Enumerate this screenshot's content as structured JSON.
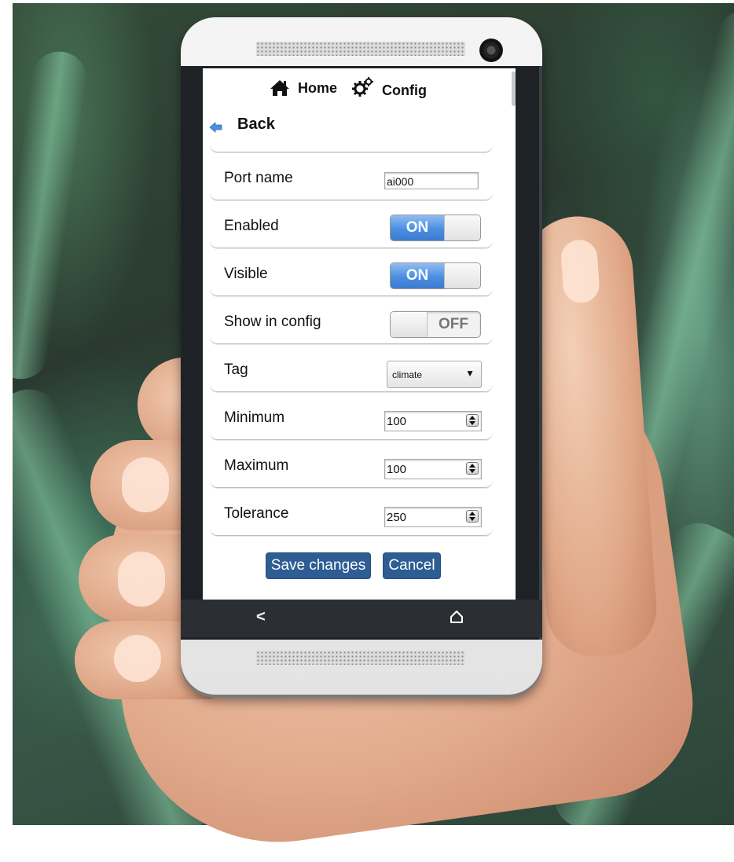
{
  "header": {
    "home_label": "Home",
    "config_label": "Config",
    "home_icon": "home-icon",
    "config_icon": "gears-icon"
  },
  "back": {
    "label": "Back",
    "icon": "back-arrow-icon"
  },
  "fields": {
    "port_name": {
      "label": "Port name",
      "value": "ai000"
    },
    "enabled": {
      "label": "Enabled",
      "state": "ON"
    },
    "visible": {
      "label": "Visible",
      "state": "ON"
    },
    "show_in_config": {
      "label": "Show in config",
      "state": "OFF"
    },
    "tag": {
      "label": "Tag",
      "selected": "climate"
    },
    "minimum": {
      "label": "Minimum",
      "value": "100"
    },
    "maximum": {
      "label": "Maximum",
      "value": "100"
    },
    "tolerance": {
      "label": "Tolerance",
      "value": "250"
    }
  },
  "actions": {
    "save_label": "Save changes",
    "cancel_label": "Cancel"
  },
  "android_nav": {
    "back_glyph": "<",
    "home_icon": "home-outline-icon"
  },
  "colors": {
    "accent_blue": "#4d8ee0",
    "button_blue": "#2e5d93"
  }
}
